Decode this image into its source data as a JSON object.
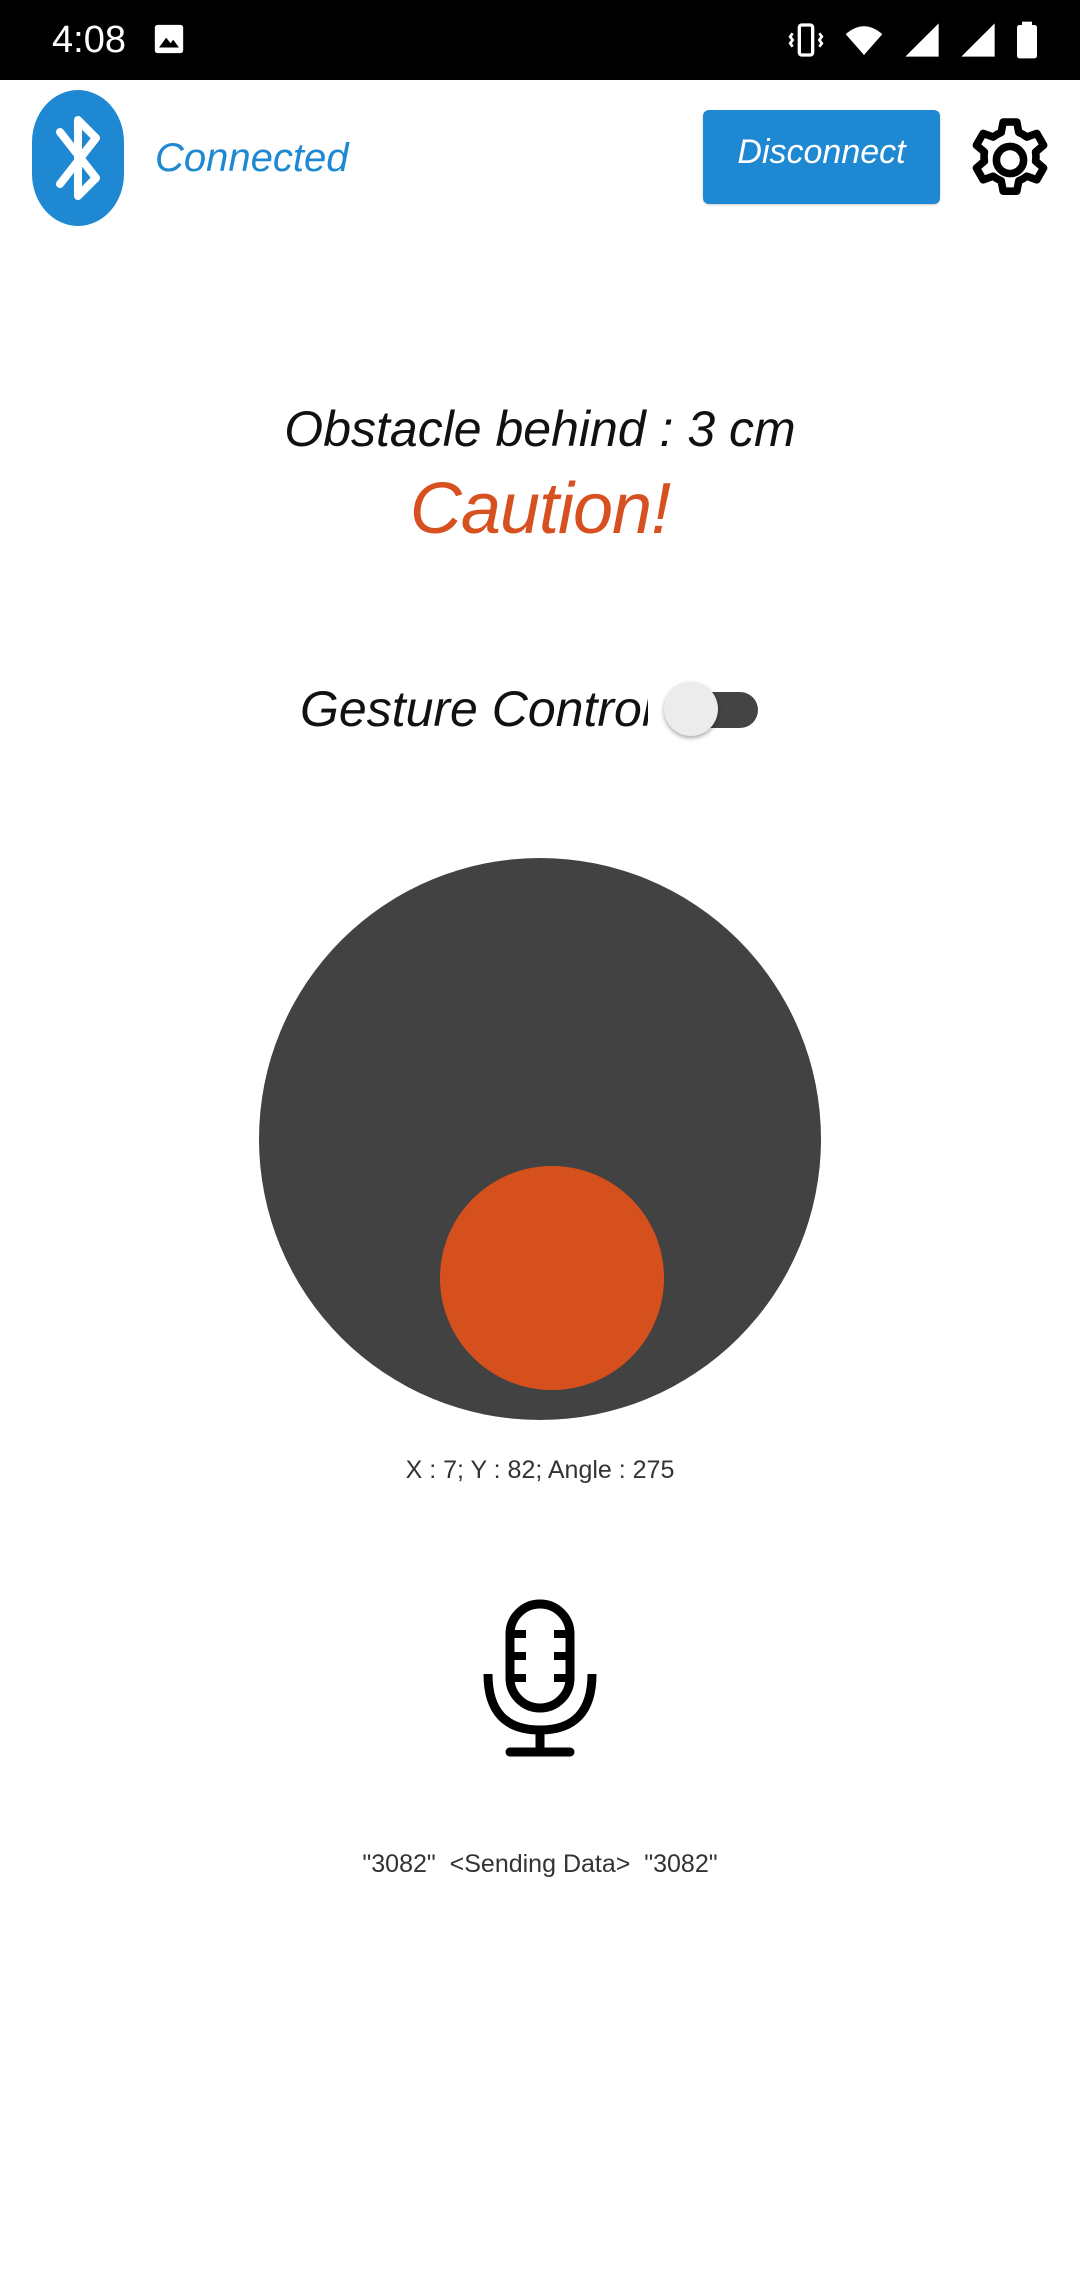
{
  "status_bar": {
    "time": "4:08",
    "icons": [
      "gallery-icon",
      "vibrate-icon",
      "wifi-icon",
      "signal-icon",
      "signal-icon",
      "battery-icon"
    ]
  },
  "header": {
    "connection_status": "Connected",
    "disconnect_label": "Disconnect",
    "settings_icon": "gear-icon",
    "bluetooth_icon": "bluetooth-icon"
  },
  "obstacle": {
    "text": "Obstacle behind : 3 cm",
    "warning": "Caution!"
  },
  "gesture_control": {
    "label": "Gesture Control",
    "enabled": false
  },
  "joystick": {
    "x": 7,
    "y": 82,
    "angle": 275,
    "readout": "X : 7; Y : 82; Angle : 275"
  },
  "voice": {
    "icon": "microphone-icon",
    "status": "\"3082\"  <Sending Data>  \"3082\""
  },
  "colors": {
    "accent_blue": "#1e88d2",
    "warning_orange": "#d65020",
    "joystick_base": "#424242",
    "joystick_knob": "#d6501e"
  }
}
